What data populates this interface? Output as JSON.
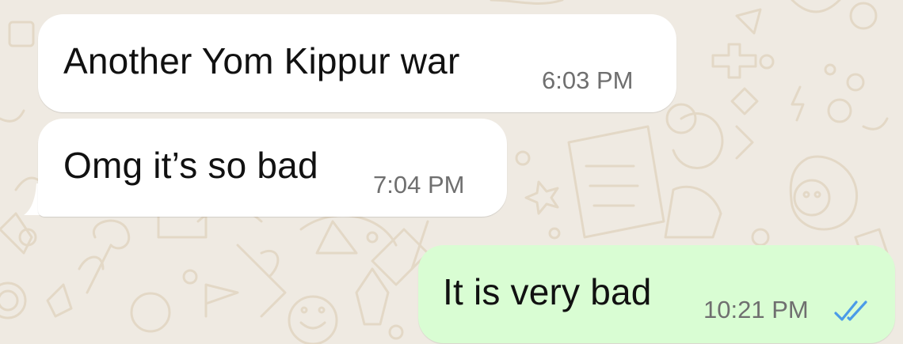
{
  "conversation": {
    "messages": [
      {
        "direction": "incoming",
        "text": "Another Yom Kippur war",
        "time": "6:03 PM"
      },
      {
        "direction": "incoming",
        "text": "Omg it’s so bad",
        "time": "7:04 PM"
      },
      {
        "direction": "outgoing",
        "text": "It is very bad",
        "time": "10:21 PM",
        "status_icon": "double-check-read-icon"
      }
    ]
  },
  "colors": {
    "wallpaper": "#efeae2",
    "incoming_bubble": "#ffffff",
    "outgoing_bubble": "#d9fdd3",
    "read_ticks": "#4a9be8",
    "timestamp": "#6f6f6f"
  }
}
